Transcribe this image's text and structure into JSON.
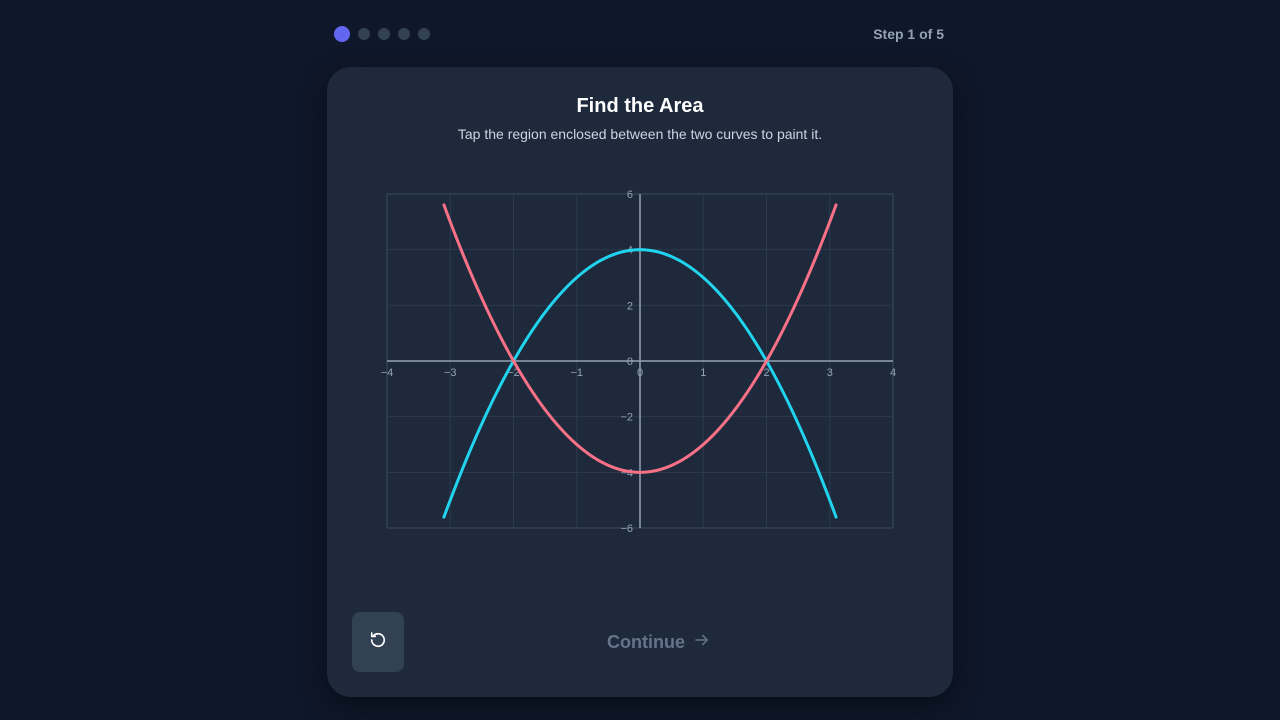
{
  "progress": {
    "total_steps": 5,
    "current_step": 1,
    "label": "Step 1 of 5"
  },
  "card": {
    "title": "Find the Area",
    "subtitle": "Tap the region enclosed between the two curves to paint it."
  },
  "controls": {
    "reset_icon": "reset-icon",
    "continue_label": "Continue",
    "continue_icon": "arrow-right-icon"
  },
  "colors": {
    "accent": "#6366f1",
    "curve_cyan": "#22d3ee",
    "curve_red": "#f87187"
  },
  "chart_data": {
    "type": "line",
    "xlim": [
      -4,
      4
    ],
    "ylim": [
      -6,
      6
    ],
    "grid": true,
    "x_ticks": [
      "−4",
      "−3",
      "−2",
      "−1",
      "0",
      "1",
      "2",
      "3",
      "4"
    ],
    "y_ticks": [
      "6",
      "4",
      "2",
      "0",
      "−2",
      "−4",
      "−6"
    ],
    "series": [
      {
        "function": "y = 4 - x^2",
        "x_range": [
          -3.1,
          3.1
        ],
        "color": "#22d3ee"
      },
      {
        "function": "y = x^2 - 4",
        "x_range": [
          -3.1,
          3.1
        ],
        "color": "#f87187"
      }
    ]
  }
}
